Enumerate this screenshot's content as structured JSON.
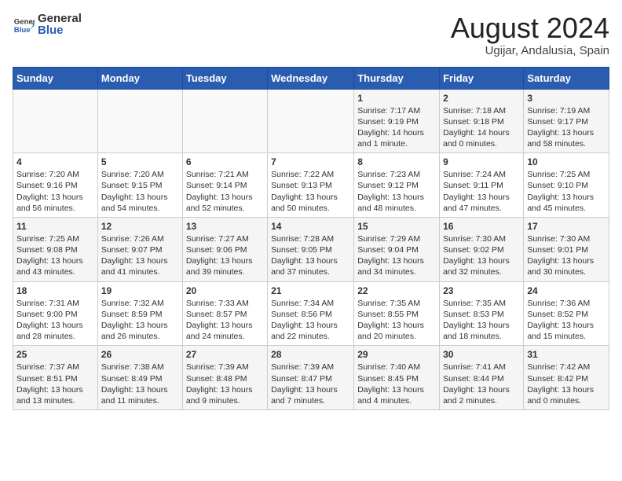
{
  "header": {
    "logo_general": "General",
    "logo_blue": "Blue",
    "month_title": "August 2024",
    "location": "Ugijar, Andalusia, Spain"
  },
  "weekdays": [
    "Sunday",
    "Monday",
    "Tuesday",
    "Wednesday",
    "Thursday",
    "Friday",
    "Saturday"
  ],
  "weeks": [
    [
      {
        "day": "",
        "text": ""
      },
      {
        "day": "",
        "text": ""
      },
      {
        "day": "",
        "text": ""
      },
      {
        "day": "",
        "text": ""
      },
      {
        "day": "1",
        "text": "Sunrise: 7:17 AM\nSunset: 9:19 PM\nDaylight: 14 hours and 1 minute."
      },
      {
        "day": "2",
        "text": "Sunrise: 7:18 AM\nSunset: 9:18 PM\nDaylight: 14 hours and 0 minutes."
      },
      {
        "day": "3",
        "text": "Sunrise: 7:19 AM\nSunset: 9:17 PM\nDaylight: 13 hours and 58 minutes."
      }
    ],
    [
      {
        "day": "4",
        "text": "Sunrise: 7:20 AM\nSunset: 9:16 PM\nDaylight: 13 hours and 56 minutes."
      },
      {
        "day": "5",
        "text": "Sunrise: 7:20 AM\nSunset: 9:15 PM\nDaylight: 13 hours and 54 minutes."
      },
      {
        "day": "6",
        "text": "Sunrise: 7:21 AM\nSunset: 9:14 PM\nDaylight: 13 hours and 52 minutes."
      },
      {
        "day": "7",
        "text": "Sunrise: 7:22 AM\nSunset: 9:13 PM\nDaylight: 13 hours and 50 minutes."
      },
      {
        "day": "8",
        "text": "Sunrise: 7:23 AM\nSunset: 9:12 PM\nDaylight: 13 hours and 48 minutes."
      },
      {
        "day": "9",
        "text": "Sunrise: 7:24 AM\nSunset: 9:11 PM\nDaylight: 13 hours and 47 minutes."
      },
      {
        "day": "10",
        "text": "Sunrise: 7:25 AM\nSunset: 9:10 PM\nDaylight: 13 hours and 45 minutes."
      }
    ],
    [
      {
        "day": "11",
        "text": "Sunrise: 7:25 AM\nSunset: 9:08 PM\nDaylight: 13 hours and 43 minutes."
      },
      {
        "day": "12",
        "text": "Sunrise: 7:26 AM\nSunset: 9:07 PM\nDaylight: 13 hours and 41 minutes."
      },
      {
        "day": "13",
        "text": "Sunrise: 7:27 AM\nSunset: 9:06 PM\nDaylight: 13 hours and 39 minutes."
      },
      {
        "day": "14",
        "text": "Sunrise: 7:28 AM\nSunset: 9:05 PM\nDaylight: 13 hours and 37 minutes."
      },
      {
        "day": "15",
        "text": "Sunrise: 7:29 AM\nSunset: 9:04 PM\nDaylight: 13 hours and 34 minutes."
      },
      {
        "day": "16",
        "text": "Sunrise: 7:30 AM\nSunset: 9:02 PM\nDaylight: 13 hours and 32 minutes."
      },
      {
        "day": "17",
        "text": "Sunrise: 7:30 AM\nSunset: 9:01 PM\nDaylight: 13 hours and 30 minutes."
      }
    ],
    [
      {
        "day": "18",
        "text": "Sunrise: 7:31 AM\nSunset: 9:00 PM\nDaylight: 13 hours and 28 minutes."
      },
      {
        "day": "19",
        "text": "Sunrise: 7:32 AM\nSunset: 8:59 PM\nDaylight: 13 hours and 26 minutes."
      },
      {
        "day": "20",
        "text": "Sunrise: 7:33 AM\nSunset: 8:57 PM\nDaylight: 13 hours and 24 minutes."
      },
      {
        "day": "21",
        "text": "Sunrise: 7:34 AM\nSunset: 8:56 PM\nDaylight: 13 hours and 22 minutes."
      },
      {
        "day": "22",
        "text": "Sunrise: 7:35 AM\nSunset: 8:55 PM\nDaylight: 13 hours and 20 minutes."
      },
      {
        "day": "23",
        "text": "Sunrise: 7:35 AM\nSunset: 8:53 PM\nDaylight: 13 hours and 18 minutes."
      },
      {
        "day": "24",
        "text": "Sunrise: 7:36 AM\nSunset: 8:52 PM\nDaylight: 13 hours and 15 minutes."
      }
    ],
    [
      {
        "day": "25",
        "text": "Sunrise: 7:37 AM\nSunset: 8:51 PM\nDaylight: 13 hours and 13 minutes."
      },
      {
        "day": "26",
        "text": "Sunrise: 7:38 AM\nSunset: 8:49 PM\nDaylight: 13 hours and 11 minutes."
      },
      {
        "day": "27",
        "text": "Sunrise: 7:39 AM\nSunset: 8:48 PM\nDaylight: 13 hours and 9 minutes."
      },
      {
        "day": "28",
        "text": "Sunrise: 7:39 AM\nSunset: 8:47 PM\nDaylight: 13 hours and 7 minutes."
      },
      {
        "day": "29",
        "text": "Sunrise: 7:40 AM\nSunset: 8:45 PM\nDaylight: 13 hours and 4 minutes."
      },
      {
        "day": "30",
        "text": "Sunrise: 7:41 AM\nSunset: 8:44 PM\nDaylight: 13 hours and 2 minutes."
      },
      {
        "day": "31",
        "text": "Sunrise: 7:42 AM\nSunset: 8:42 PM\nDaylight: 13 hours and 0 minutes."
      }
    ]
  ]
}
